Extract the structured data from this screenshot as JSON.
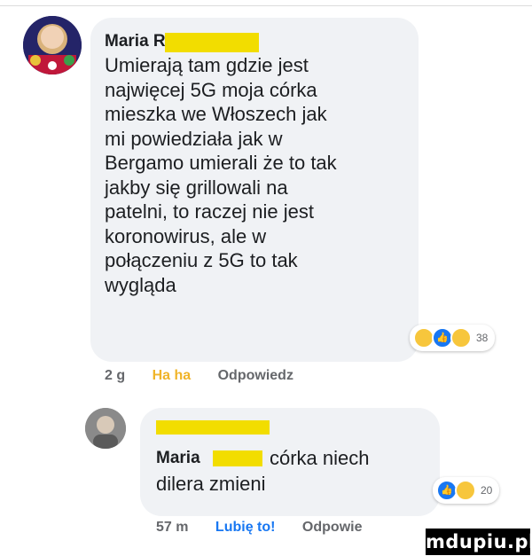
{
  "comment1": {
    "author": "Maria R",
    "lines": [
      "Umierają tam gdzie jest",
      "najwięcej 5G moja córka",
      "mieszka we Włoszech jak",
      "mi powiedziała jak w",
      "Bergamo umierali że to tak",
      "jakby się grillowali na",
      "patelni, to raczej nie jest",
      "koronowirus, ale w",
      "połączeniu z 5G to tak",
      "wygląda"
    ],
    "reactions": {
      "types": [
        "haha",
        "like",
        "wow"
      ],
      "count": "38"
    },
    "meta": {
      "time": "2 g",
      "reaction_label": "Ha ha",
      "reply_label": "Odpowiedz"
    }
  },
  "comment2": {
    "author_mention": "Maria",
    "text_suffix": "córka niech",
    "text_line2": "dilera zmieni",
    "reactions": {
      "types": [
        "like",
        "haha"
      ],
      "count": "20"
    },
    "meta": {
      "time": "57 m",
      "like_label": "Lubię to!",
      "reply_label": "Odpowie"
    }
  },
  "watermark": {
    "text": "mdupiu.pl"
  },
  "colors": {
    "bubble": "#f0f2f5",
    "redaction": "#f2dd00",
    "haha": "#f0b429",
    "like": "#1877f2",
    "meta": "#65676b"
  }
}
